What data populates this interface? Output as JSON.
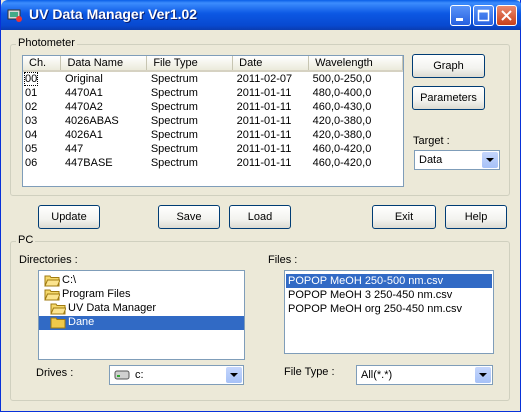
{
  "window": {
    "title": "UV Data Manager Ver1.02"
  },
  "photometer": {
    "label": "Photometer",
    "columns": [
      "Ch.",
      "Data Name",
      "File Type",
      "Date",
      "Wavelength"
    ],
    "rows": [
      [
        "00",
        "Original",
        "Spectrum",
        "2011-02-07",
        "500,0-250,0"
      ],
      [
        "01",
        "4470A1",
        "Spectrum",
        "2011-01-11",
        "480,0-400,0"
      ],
      [
        "02",
        "4470A2",
        "Spectrum",
        "2011-01-11",
        "460,0-430,0"
      ],
      [
        "03",
        "4026ABAS",
        "Spectrum",
        "2011-01-11",
        "420,0-380,0"
      ],
      [
        "04",
        "4026A1",
        "Spectrum",
        "2011-01-11",
        "420,0-380,0"
      ],
      [
        "05",
        "447",
        "Spectrum",
        "2011-01-11",
        "460,0-420,0"
      ],
      [
        "06",
        "447BASE",
        "Spectrum",
        "2011-01-11",
        "460,0-420,0"
      ]
    ],
    "graph_label": "Graph",
    "parameters_label": "Parameters",
    "target_label": "Target :",
    "target_value": "Data"
  },
  "actions": {
    "update_label": "Update",
    "save_label": "Save",
    "load_label": "Load",
    "exit_label": "Exit",
    "help_label": "Help"
  },
  "pc": {
    "label": "PC",
    "directories_label": "Directories :",
    "directories": [
      {
        "name": "C:\\",
        "selected": false
      },
      {
        "name": "Program Files",
        "selected": false
      },
      {
        "name": "UV Data Manager",
        "selected": false
      },
      {
        "name": "Dane",
        "selected": true
      }
    ],
    "files_label": "Files :",
    "files": [
      {
        "name": "POPOP MeOH 250-500 nm.csv",
        "selected": true
      },
      {
        "name": "POPOP MeOH 3 250-450 nm.csv",
        "selected": false
      },
      {
        "name": "POPOP MeOH org 250-450 nm.csv",
        "selected": false
      }
    ],
    "drives_label": "Drives :",
    "drive_value": "c:",
    "file_type_label": "File Type :",
    "file_type_value": "All(*.*)"
  },
  "colors": {
    "selection": "#316ac5",
    "title_bar": "#0a5ee8",
    "face": "#ece9d8"
  }
}
